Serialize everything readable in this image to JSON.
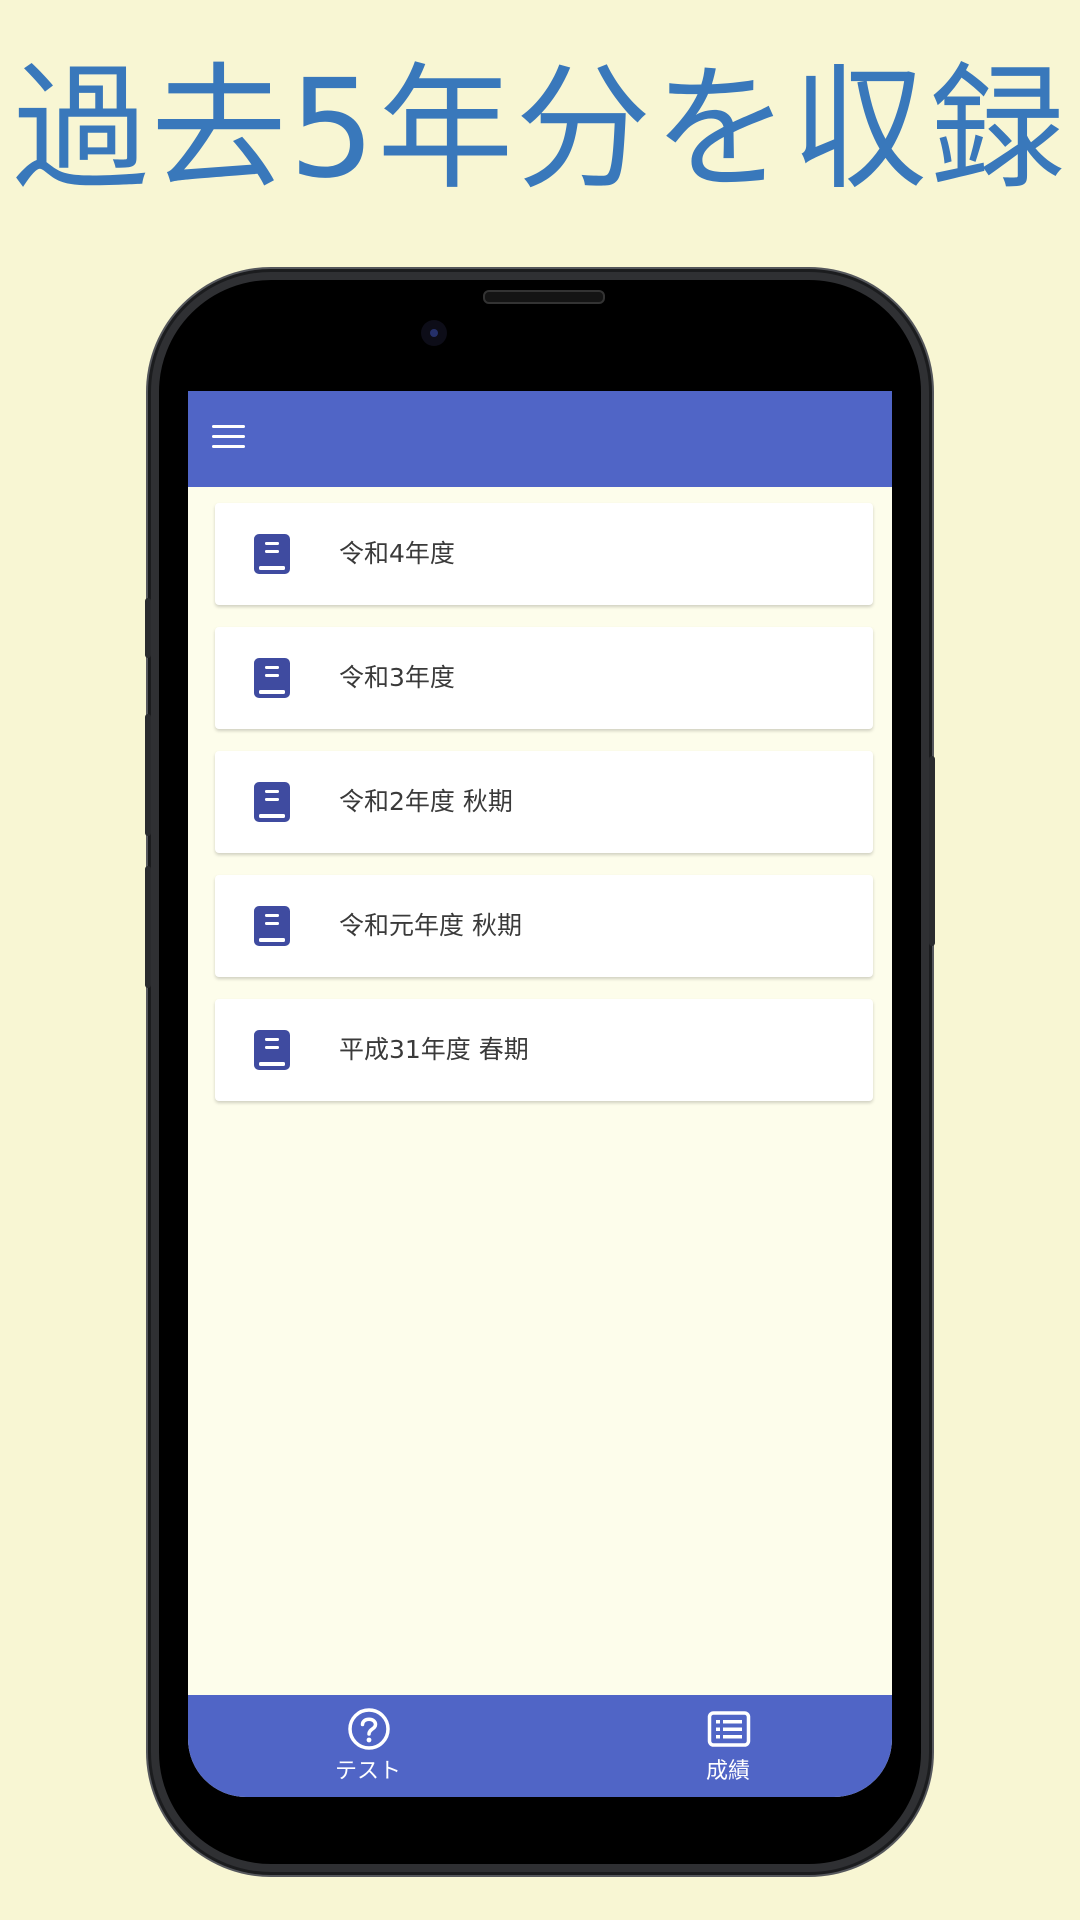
{
  "headline": "過去5年分を収録",
  "colors": {
    "background": "#f8f6d3",
    "headline": "#3978bb",
    "app_bar": "#5065c6",
    "screen_background": "#fdfdeb",
    "book_icon": "#3f4ba0"
  },
  "app": {
    "menu_icon": "hamburger-menu-icon",
    "items": [
      {
        "label": "令和4年度",
        "icon": "book-icon"
      },
      {
        "label": "令和3年度",
        "icon": "book-icon"
      },
      {
        "label": "令和2年度 秋期",
        "icon": "book-icon"
      },
      {
        "label": "令和元年度 秋期",
        "icon": "book-icon"
      },
      {
        "label": "平成31年度 春期",
        "icon": "book-icon"
      }
    ],
    "bottom_nav": [
      {
        "label": "テスト",
        "icon": "question-circle-icon"
      },
      {
        "label": "成績",
        "icon": "list-icon"
      }
    ]
  }
}
